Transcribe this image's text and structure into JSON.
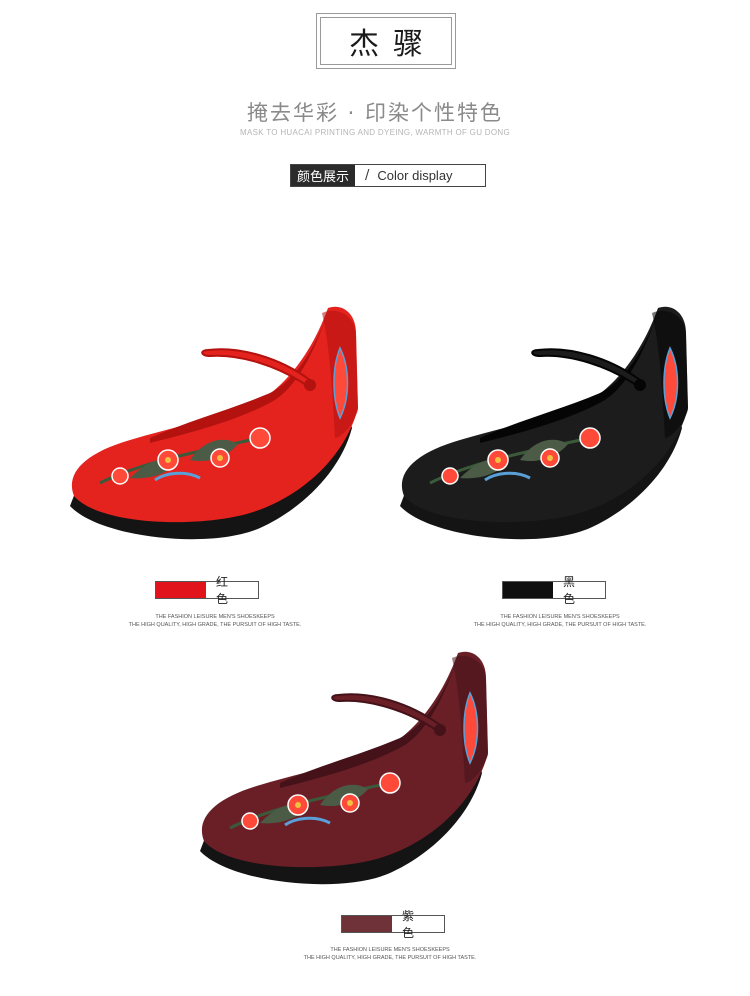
{
  "brand": {
    "title": "杰骤"
  },
  "slogan": {
    "main": "掩去华彩 · 印染个性特色",
    "sub": "MASK TO HUACAI PRINTING AND DYEING, WARMTH OF GU DONG"
  },
  "section": {
    "title_zh": "颜色展示",
    "separator": "/",
    "title_en": "Color display"
  },
  "products": [
    {
      "color_name": "红 色",
      "swatch": "#e0141a",
      "body_color": "#e4231f",
      "shade_color": "#b3120f",
      "tagline_1": "THE FASHION LEISURE MEN'S SHOESKEEPS",
      "tagline_2": "THE HIGH QUALITY, HIGH GRADE, THE PURSUIT OF HIGH TASTE."
    },
    {
      "color_name": "黑 色",
      "swatch": "#0f0f0f",
      "body_color": "#1c1c1c",
      "shade_color": "#050505",
      "tagline_1": "THE FASHION LEISURE MEN'S SHOESKEEPS",
      "tagline_2": "THE HIGH QUALITY, HIGH GRADE, THE PURSUIT OF HIGH TASTE."
    },
    {
      "color_name": "紫 色",
      "swatch": "#6e3238",
      "body_color": "#6a1f27",
      "shade_color": "#45121a",
      "tagline_1": "THE FASHION LEISURE MEN'S SHOESKEEPS",
      "tagline_2": "THE HIGH QUALITY, HIGH GRADE, THE PURSUIT OF HIGH TASTE."
    }
  ]
}
